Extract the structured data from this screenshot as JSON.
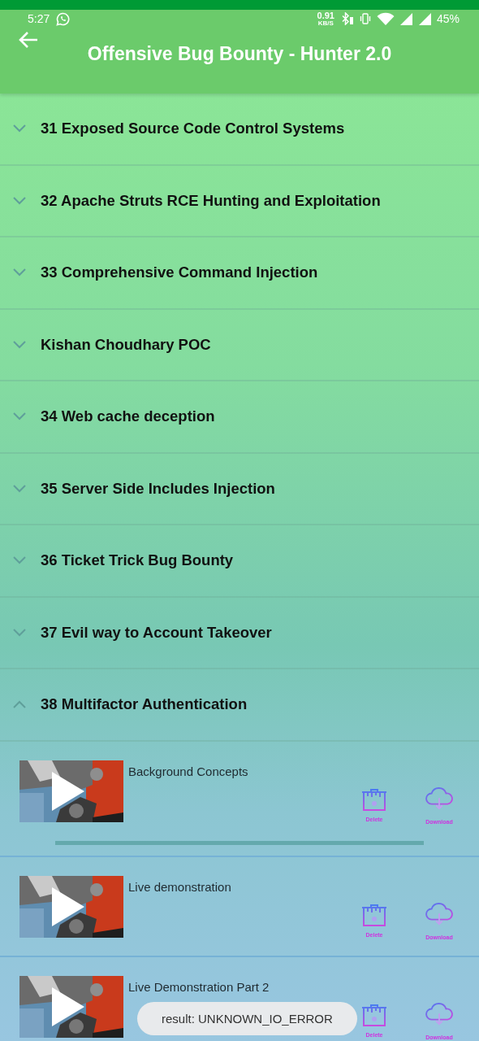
{
  "status_bar": {
    "time": "5:27",
    "net_speed": "0.91",
    "net_unit": "KB/S",
    "battery": "45%"
  },
  "app_bar": {
    "title": "Offensive Bug Bounty - Hunter 2.0"
  },
  "sections": [
    {
      "title": "31 Exposed Source Code Control Systems",
      "expanded": false
    },
    {
      "title": "32 Apache Struts RCE Hunting and Exploitation",
      "expanded": false
    },
    {
      "title": "33 Comprehensive Command Injection",
      "expanded": false
    },
    {
      "title": "Kishan Choudhary POC",
      "expanded": false
    },
    {
      "title": "34 Web cache deception",
      "expanded": false
    },
    {
      "title": "35 Server Side Includes Injection",
      "expanded": false
    },
    {
      "title": "36 Ticket Trick Bug Bounty",
      "expanded": false
    },
    {
      "title": "37 Evil way to Account Takeover",
      "expanded": false
    },
    {
      "title": "38 Multifactor Authentication",
      "expanded": true,
      "videos": [
        {
          "title": "Background Concepts",
          "delete_label": "Delete",
          "download_label": "Download",
          "progress": {
            "level": 1
          }
        },
        {
          "title": "Live demonstration",
          "delete_label": "Delete",
          "download_label": "Download"
        },
        {
          "title": "Live Demonstration Part 2",
          "delete_label": "Delete",
          "download_label": "Download"
        }
      ]
    }
  ],
  "toast": {
    "text": "result: UNKNOWN_IO_ERROR"
  }
}
